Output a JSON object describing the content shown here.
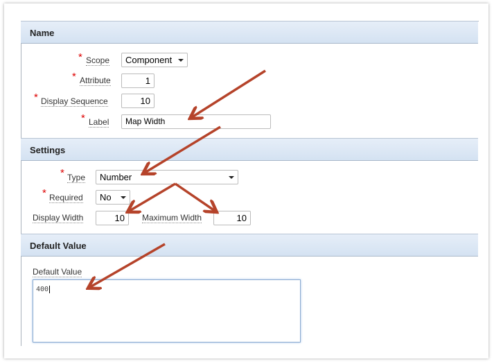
{
  "sections": {
    "name": "Name",
    "settings": "Settings",
    "default": "Default Value"
  },
  "name": {
    "scope_label": "Scope",
    "scope_value": "Component",
    "attribute_label": "Attribute",
    "attribute_value": "1",
    "seq_label": "Display Sequence",
    "seq_value": "10",
    "label_label": "Label",
    "label_value": "Map Width"
  },
  "settings": {
    "type_label": "Type",
    "type_value": "Number",
    "required_label": "Required",
    "required_value": "No",
    "dw_label": "Display Width",
    "dw_value": "10",
    "mw_label": "Maximum Width",
    "mw_value": "10"
  },
  "default": {
    "label": "Default Value",
    "value": "400"
  },
  "required_marker": "*",
  "colors": {
    "arrow": "#b5432a",
    "header": "#dbe6f4"
  }
}
